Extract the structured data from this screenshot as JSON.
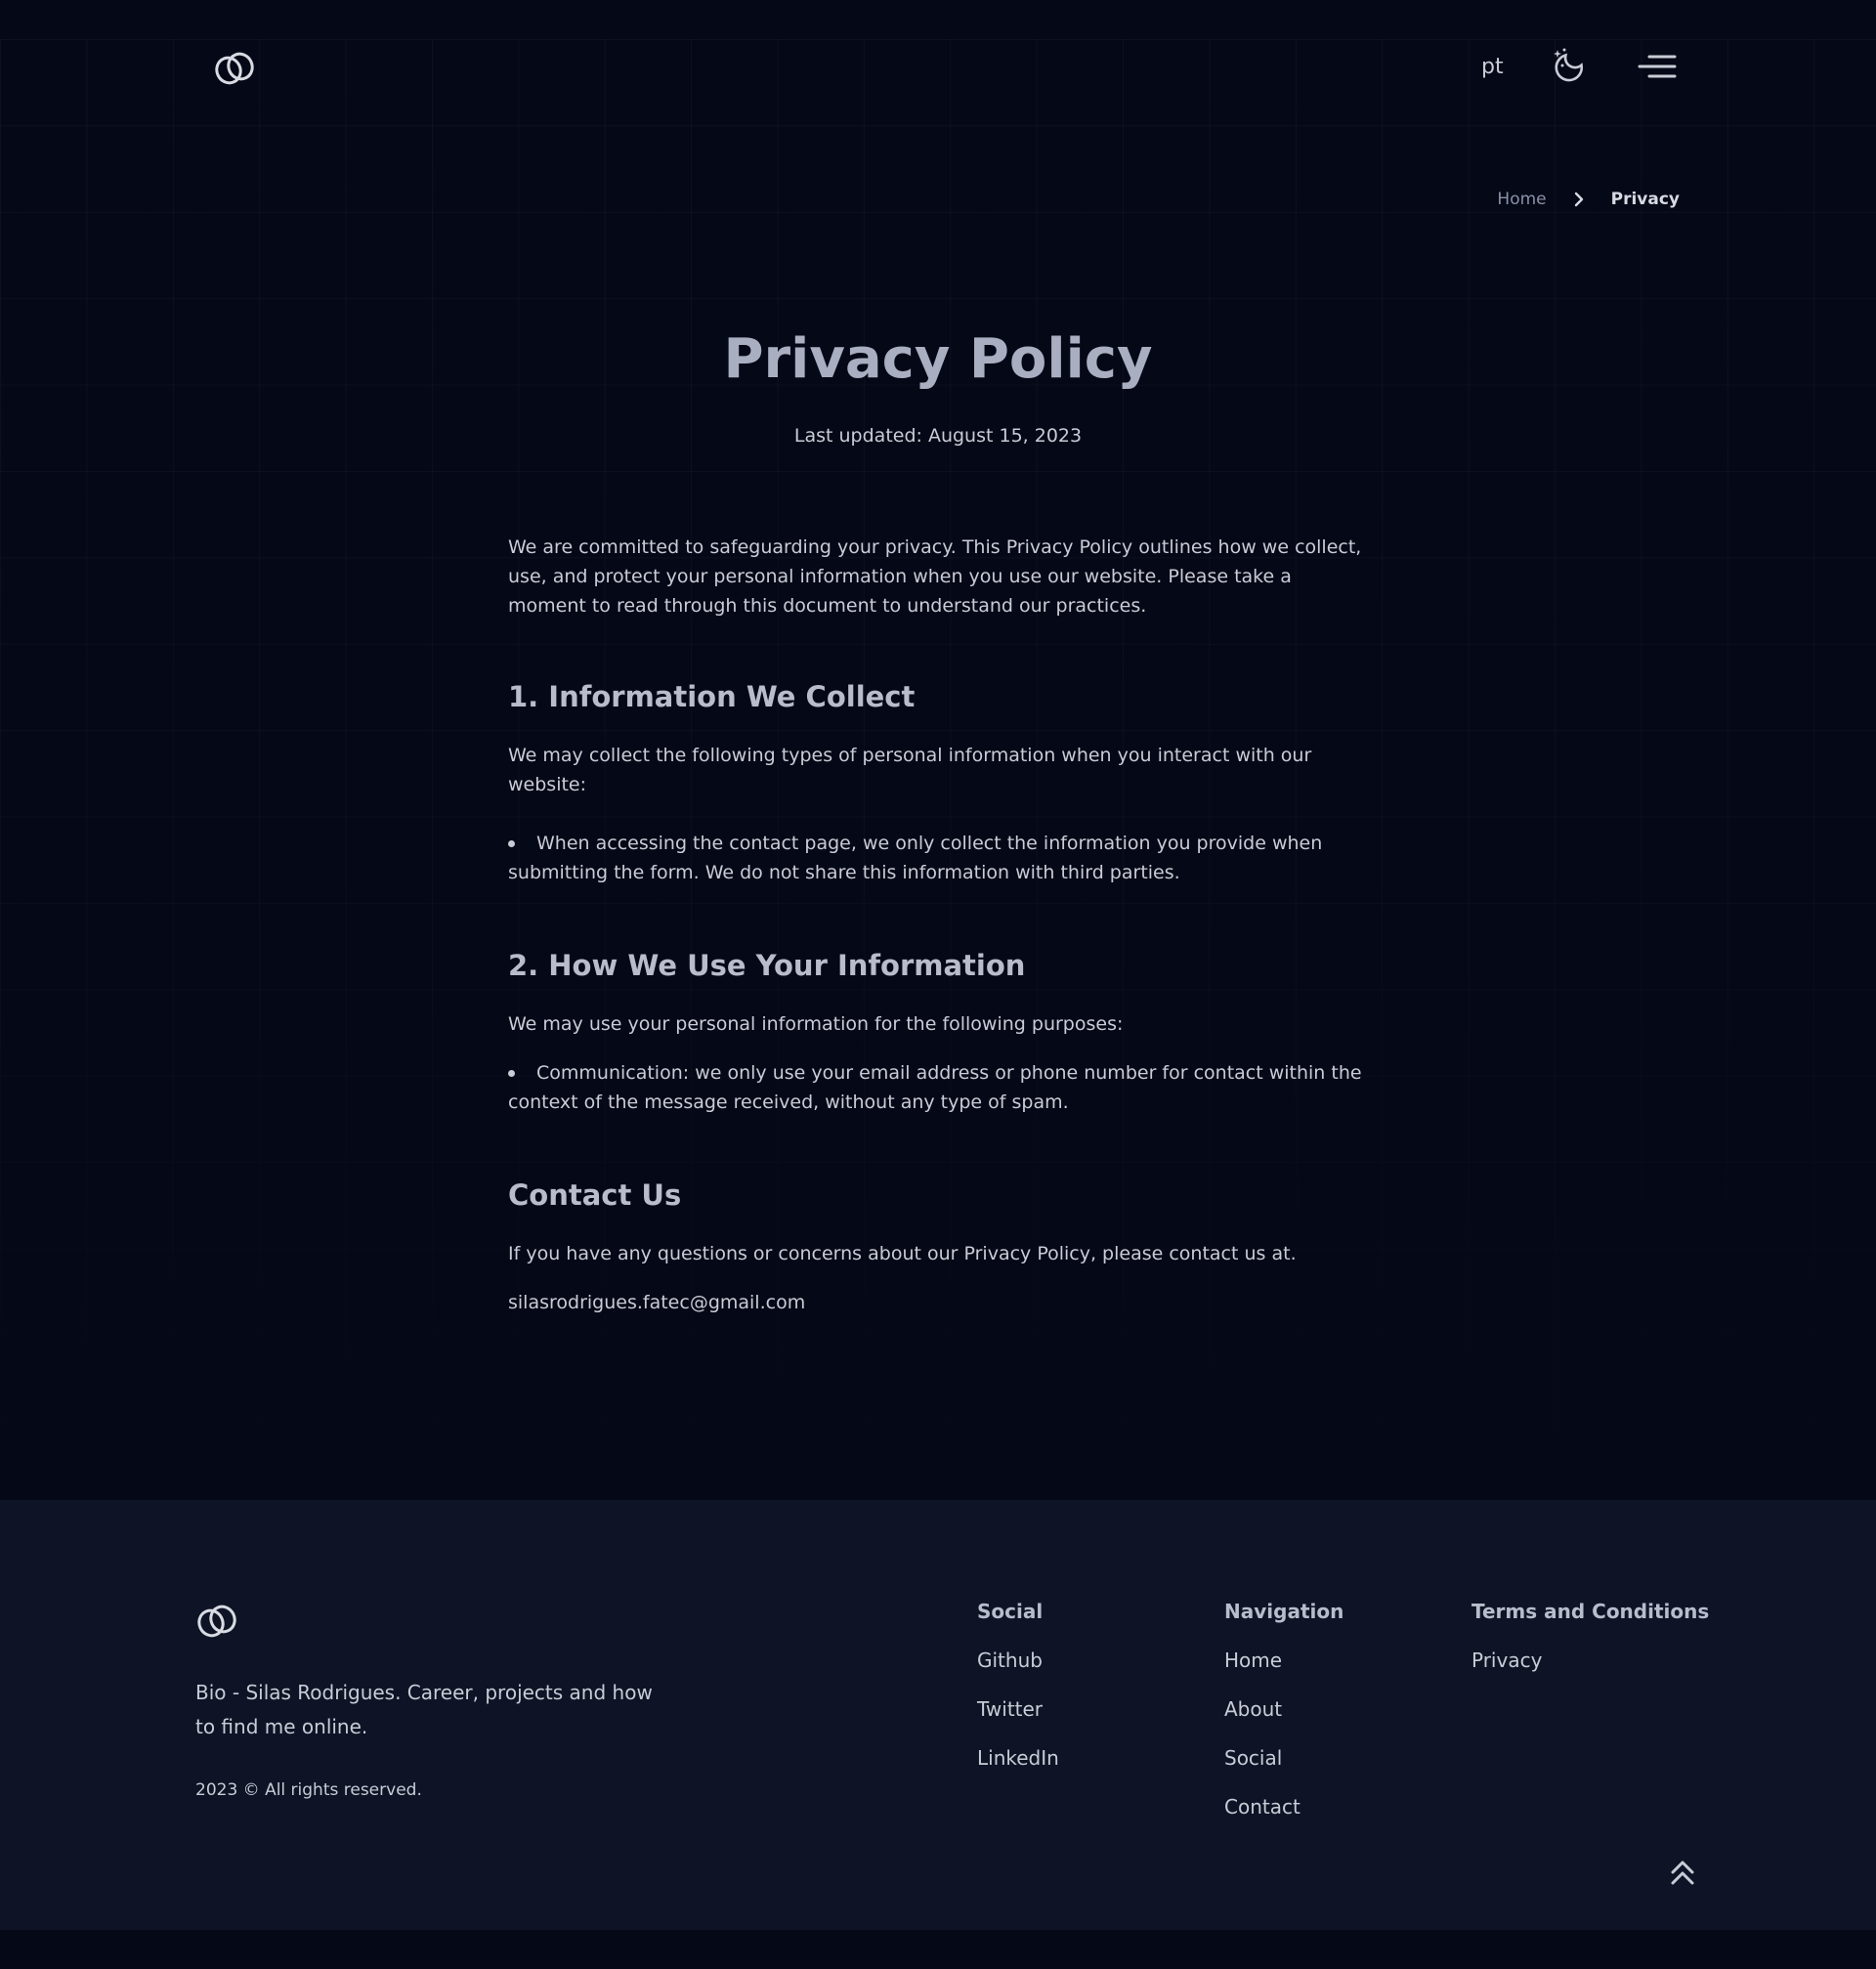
{
  "header": {
    "language_label": "pt",
    "icons": {
      "logo": "double-ring-logo-icon",
      "theme": "moon-stars-icon",
      "menu": "hamburger-menu-icon"
    }
  },
  "breadcrumb": {
    "home": "Home",
    "current": "Privacy"
  },
  "page": {
    "title": "Privacy Policy",
    "last_updated": "Last updated: August 15, 2023",
    "intro": "We are committed to safeguarding your privacy. This Privacy Policy outlines how we collect, use, and protect your personal information when you use our website. Please take a moment to read through this document to understand our practices.",
    "sections": [
      {
        "heading": "1. Information We Collect",
        "text": "We may collect the following types of personal information when you interact with our website:",
        "bullet_line1": "When accessing the contact page, we only collect the information you provide when",
        "bullet_line2": "submitting the form. We do not share this information with third parties."
      },
      {
        "heading": "2. How We Use Your Information",
        "text": "We may use your personal information for the following purposes:",
        "bullet_line1": "Communication: we only use your email address or phone number for contact within the",
        "bullet_line2": "context of the message received, without any type of spam."
      },
      {
        "heading": "Contact Us",
        "text": "If you have any questions or concerns about our Privacy Policy, please contact us at.",
        "email": "silasrodrigues.fatec@gmail.com"
      }
    ]
  },
  "footer": {
    "bio": "Bio - Silas Rodrigues. Career, projects and how to find me online.",
    "copyright": "2023 © All rights reserved.",
    "columns": [
      {
        "title": "Social",
        "links": [
          "Github",
          "Twitter",
          "LinkedIn"
        ]
      },
      {
        "title": "Navigation",
        "links": [
          "Home",
          "About",
          "Social",
          "Contact"
        ]
      },
      {
        "title": "Terms and Conditions",
        "links": [
          "Privacy"
        ]
      }
    ],
    "icons": {
      "back_to_top": "double-chevron-up-icon"
    }
  },
  "colors": {
    "background": "#050816",
    "footer_background": "#0e1426",
    "text": "#c9ccd6",
    "heading": "#b8bccb",
    "title": "#a9aec0"
  }
}
